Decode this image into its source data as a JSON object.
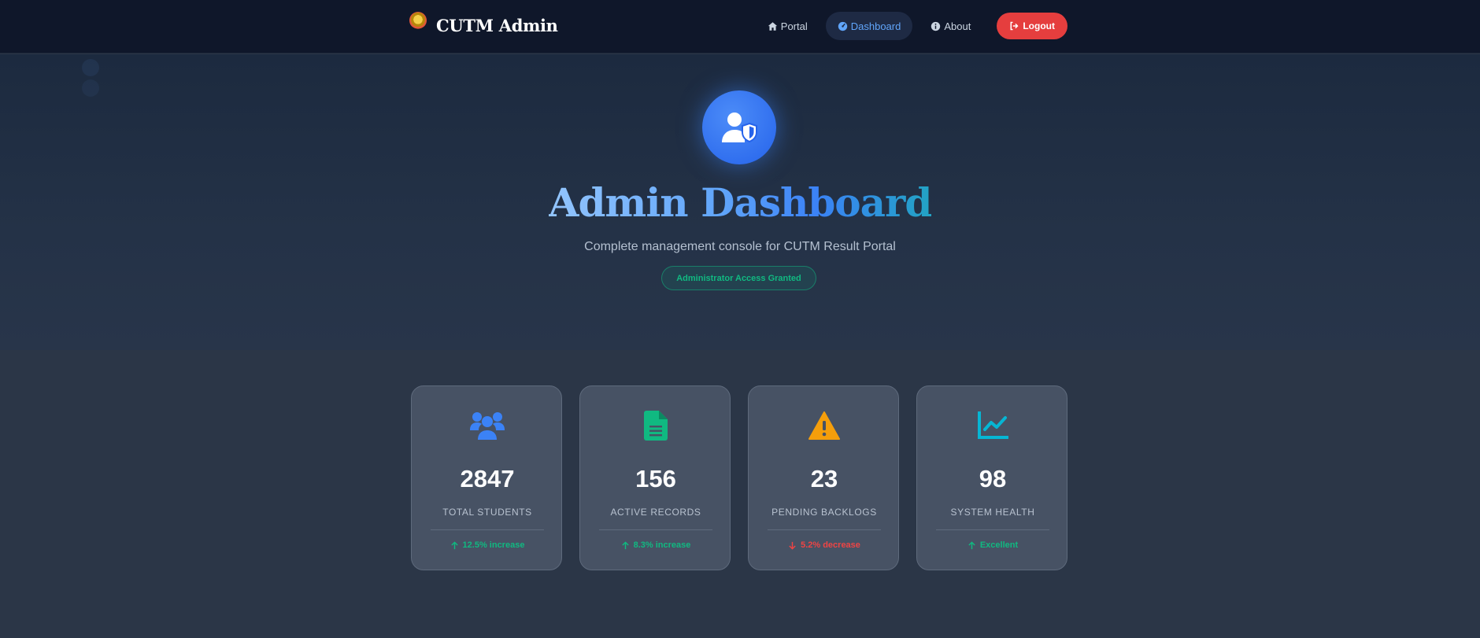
{
  "navbar": {
    "brand": "CUTM Admin",
    "items": [
      {
        "label": "Portal",
        "icon": "home-icon",
        "active": false
      },
      {
        "label": "Dashboard",
        "icon": "gauge-icon",
        "active": true
      },
      {
        "label": "About",
        "icon": "info-icon",
        "active": false
      }
    ],
    "logout_label": "Logout"
  },
  "hero": {
    "icon": "user-shield-icon",
    "title": "Admin Dashboard",
    "subtitle": "Complete management console for CUTM Result Portal",
    "badge": "Administrator Access Granted"
  },
  "stats": [
    {
      "icon": "users-icon",
      "icon_color": "#3b82f6",
      "value": "2847",
      "label": "TOTAL STUDENTS",
      "trend": "12.5% increase",
      "trend_dir": "up"
    },
    {
      "icon": "file-icon",
      "icon_color": "#10b981",
      "value": "156",
      "label": "ACTIVE RECORDS",
      "trend": "8.3% increase",
      "trend_dir": "up"
    },
    {
      "icon": "warning-icon",
      "icon_color": "#f59e0b",
      "value": "23",
      "label": "PENDING BACKLOGS",
      "trend": "5.2% decrease",
      "trend_dir": "down"
    },
    {
      "icon": "chart-line-icon",
      "icon_color": "#06b6d4",
      "value": "98",
      "label": "SYSTEM HEALTH",
      "trend": "Excellent",
      "trend_dir": "up"
    }
  ],
  "colors": {
    "accent": "#3b82f6",
    "success": "#10b981",
    "danger": "#ef4444",
    "logout": "#e53e3e"
  }
}
